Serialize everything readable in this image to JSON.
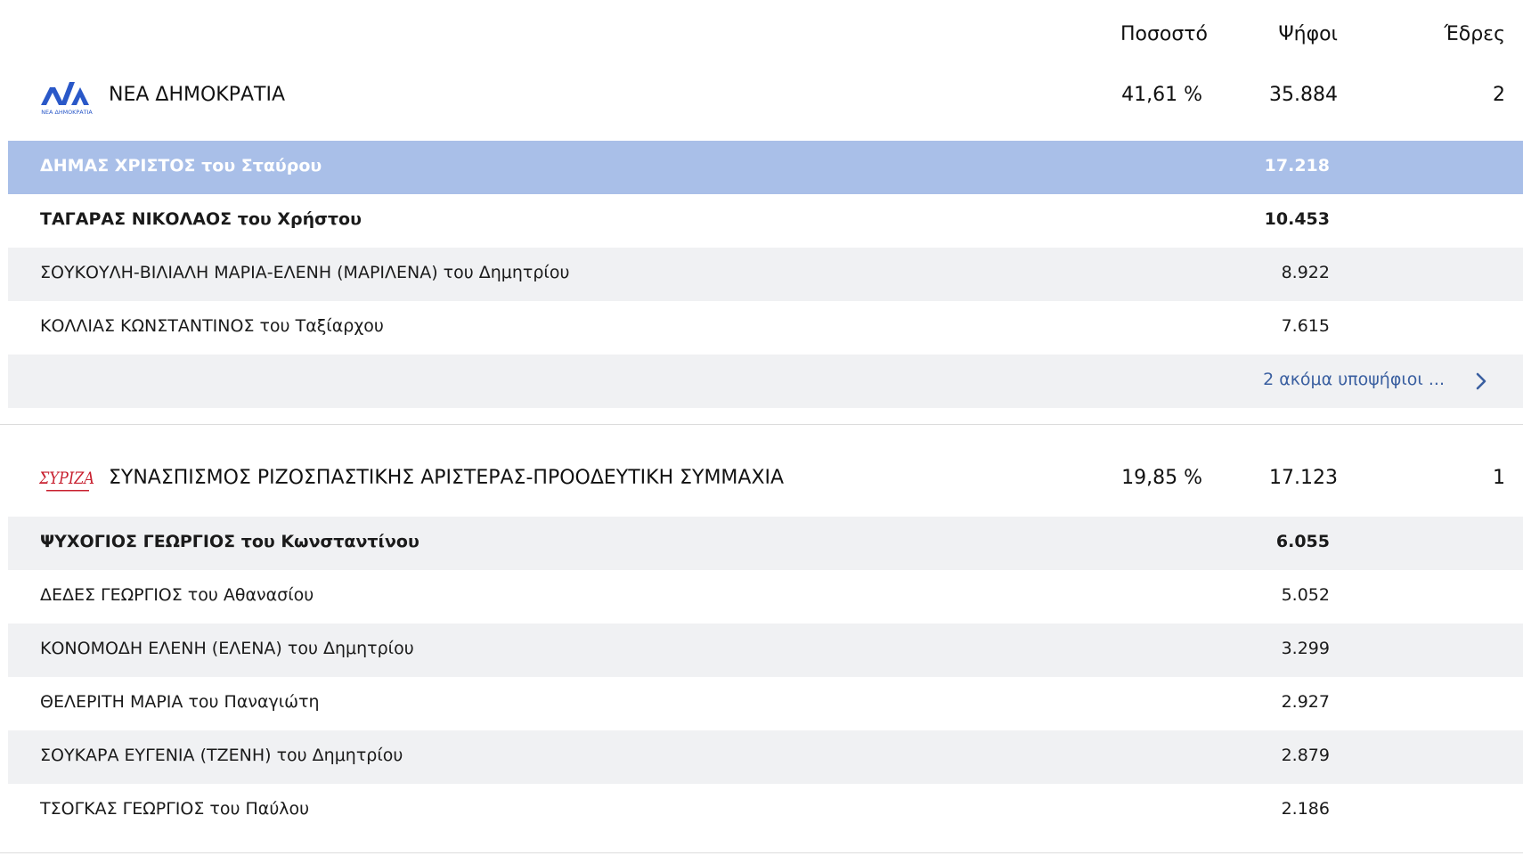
{
  "columns": {
    "percent": "Ποσοστό",
    "votes": "Ψήφοι",
    "seats": "Έδρες"
  },
  "parties": [
    {
      "name": "ΝΕΑ ΔΗΜΟΚΡΑΤΙΑ",
      "logo_icon": "nd-logo-icon",
      "logo_text": "ΝΕΑ ΔΗΜΟΚΡΑΤΙΑ",
      "percent": "41,61 %",
      "votes": "35.884",
      "seats": "2",
      "candidates": [
        {
          "name": "ΔΗΜΑΣ ΧΡΙΣΤΟΣ του Σταύρου",
          "votes": "17.218"
        },
        {
          "name": "ΤΑΓΑΡΑΣ ΝΙΚΟΛΑΟΣ του Χρήστου",
          "votes": "10.453"
        },
        {
          "name": "ΣΟΥΚΟΥΛΗ-ΒΙΛΙΑΛΗ ΜΑΡΙΑ-ΕΛΕΝΗ (ΜΑΡΙΛΕΝΑ) του Δημητρίου",
          "votes": "8.922"
        },
        {
          "name": "ΚΟΛΛΙΑΣ ΚΩΝΣΤΑΝΤΙΝΟΣ του Ταξίαρχου",
          "votes": "7.615"
        }
      ],
      "more_label": "2 ακόμα υποψήφιοι ..."
    },
    {
      "name": "ΣΥΝΑΣΠΙΣΜΟΣ ΡΙΖΟΣΠΑΣΤΙΚΗΣ ΑΡΙΣΤΕΡΑΣ-ΠΡΟΟΔΕΥΤΙΚΗ ΣΥΜΜΑΧΙΑ",
      "logo_icon": "syriza-logo-icon",
      "logo_text": "ΣΥΡΙΖΑ",
      "percent": "19,85 %",
      "votes": "17.123",
      "seats": "1",
      "candidates": [
        {
          "name": "ΨΥΧΟΓΙΟΣ ΓΕΩΡΓΙΟΣ του Κωνσταντίνου",
          "votes": "6.055"
        },
        {
          "name": "ΔΕΔΕΣ ΓΕΩΡΓΙΟΣ του Αθανασίου",
          "votes": "5.052"
        },
        {
          "name": "ΚΟΝΟΜΟΔΗ ΕΛΕΝΗ (ΕΛΕΝΑ) του Δημητρίου",
          "votes": "3.299"
        },
        {
          "name": "ΘΕΛΕΡΙΤΗ ΜΑΡΙΑ του Παναγιώτη",
          "votes": "2.927"
        },
        {
          "name": "ΣΟΥΚΑΡΑ ΕΥΓΕΝΙΑ (ΤΖΕΝΗ) του Δημητρίου",
          "votes": "2.879"
        },
        {
          "name": "ΤΣΟΓΚΑΣ ΓΕΩΡΓΙΟΣ του Παύλου",
          "votes": "2.186"
        }
      ]
    }
  ],
  "colors": {
    "selected_row": "#a9bfe8",
    "alt_row": "#f0f1f3",
    "link": "#3a5fa0",
    "nd_blue": "#2a58c8",
    "syriza_red": "#c8202f"
  }
}
